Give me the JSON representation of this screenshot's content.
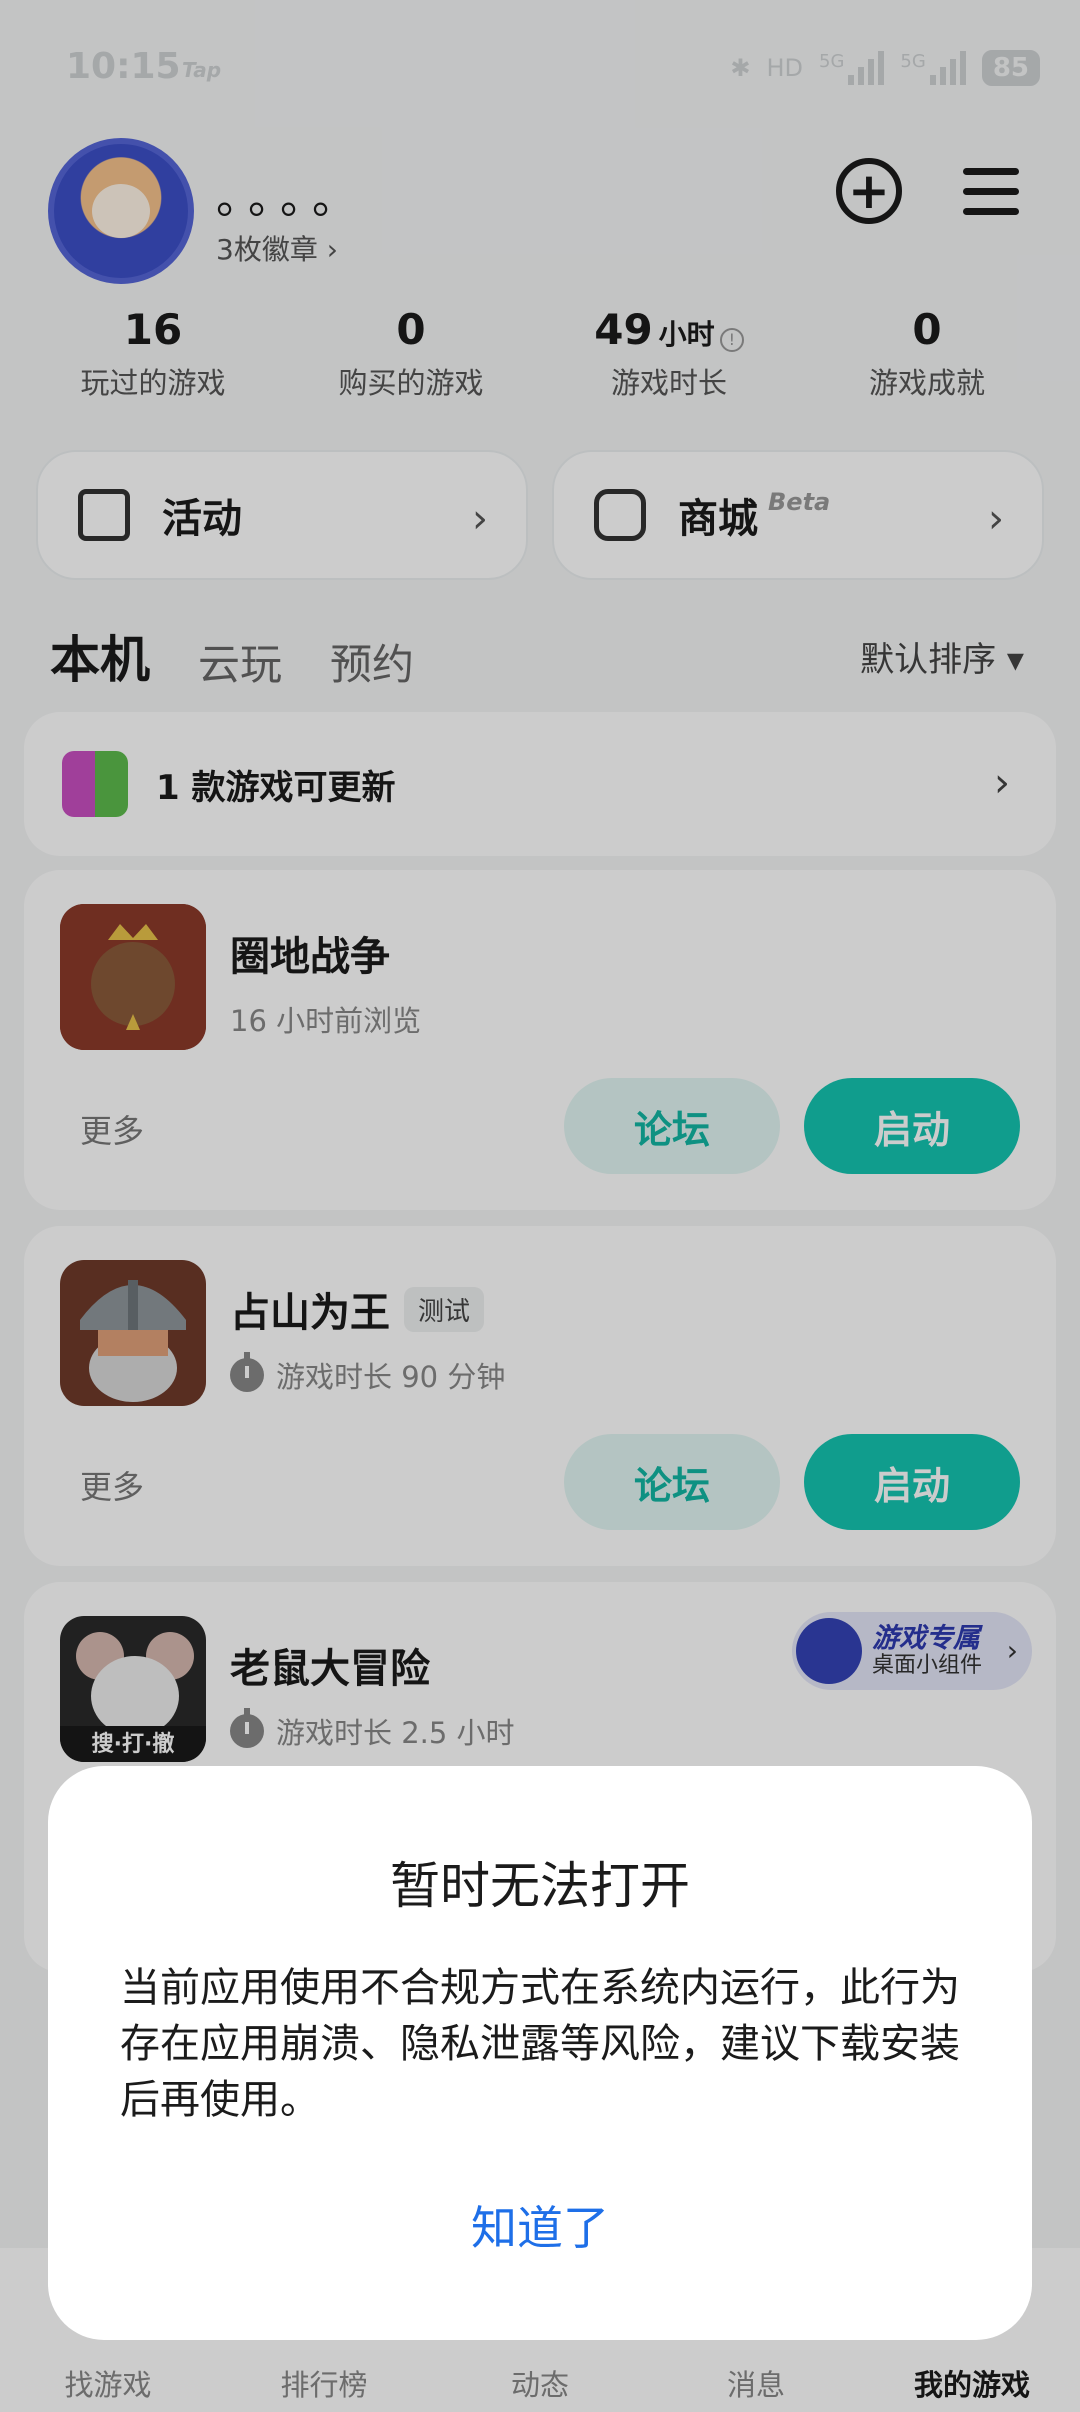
{
  "status": {
    "time": "10:15",
    "app_tag": "Tap",
    "hd": "HD",
    "net1": "5G",
    "net2": "5G",
    "battery": "85"
  },
  "profile": {
    "name": "。。。。",
    "badges": "3枚徽章 ›"
  },
  "stats": [
    {
      "value": "16",
      "unit": "",
      "label": "玩过的游戏"
    },
    {
      "value": "0",
      "unit": "",
      "label": "购买的游戏"
    },
    {
      "value": "49",
      "unit": "小时",
      "label": "游戏时长"
    },
    {
      "value": "0",
      "unit": "",
      "label": "游戏成就"
    }
  ],
  "quick": {
    "activity": "活动",
    "store": "商城",
    "beta": "Beta"
  },
  "tabs": {
    "local": "本机",
    "cloud": "云玩",
    "reserve": "预约",
    "sort": "默认排序 ▾"
  },
  "update": {
    "text": "1 款游戏可更新"
  },
  "games": [
    {
      "title": "圈地战争",
      "sub": "16 小时前浏览",
      "more": "更多",
      "forum": "论坛",
      "start": "启动"
    },
    {
      "title": "占山为王",
      "tag": "测试",
      "sub": "游戏时长 90 分钟",
      "more": "更多",
      "forum": "论坛",
      "start": "启动"
    },
    {
      "title": "老鼠大冒险",
      "sub": "游戏时长 2.5 小时",
      "icon_caption": "搜·打·撤",
      "widget_title": "游戏专属",
      "widget_sub": "桌面小组件"
    }
  ],
  "nav": [
    "找游戏",
    "排行榜",
    "动态",
    "消息",
    "我的游戏"
  ],
  "dialog": {
    "title": "暂时无法打开",
    "message": "当前应用使用不合规方式在系统内运行，此行为存在应用崩溃、隐私泄露等风险，建议下载安装后再使用。",
    "button": "知道了"
  },
  "colors": {
    "accent": "#15c5b1",
    "link": "#1e6fe8"
  }
}
